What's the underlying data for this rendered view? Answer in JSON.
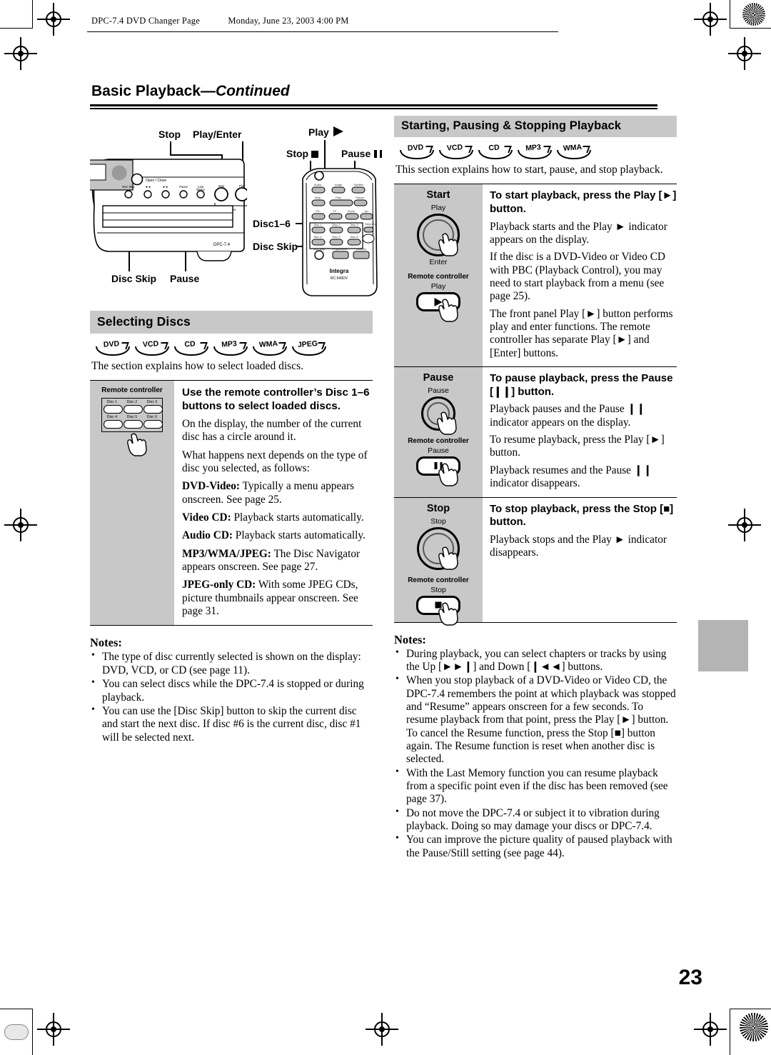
{
  "running_header": {
    "document": "DPC-7.4 DVD Changer  Page",
    "date": "Monday, June 23, 2003  4:00 PM"
  },
  "page_title": {
    "main": "Basic Playback",
    "continued": "—Continued"
  },
  "folio": "23",
  "illustration": {
    "front_panel_labels": {
      "stop": "Stop",
      "play_enter": "Play/Enter",
      "disc_skip": "Disc Skip",
      "pause": "Pause"
    },
    "front_panel_model": "DPC-7.4",
    "remote_labels": {
      "play": "Play",
      "stop": "Stop",
      "pause": "Pause",
      "disc_1_6": "Disc1–6",
      "disc_skip": "Disc Skip"
    },
    "remote_brand": "Integra",
    "remote_model": "RC-540DV"
  },
  "left_column": {
    "section_title": "Selecting Discs",
    "badges": [
      "DVD",
      "VCD",
      "CD",
      "MP3",
      "WMA",
      "JPEG"
    ],
    "intro": "The section explains how to select loaded discs.",
    "procedure": {
      "device_caption": "Remote controller",
      "keypad": [
        "Disc 1",
        "Disc 2",
        "Disc 3",
        "Disc 4",
        "Disc 5",
        "Disc 6"
      ],
      "heading": "Use the remote controller’s Disc 1–6 buttons to select loaded discs.",
      "paragraphs": [
        "On the display, the number of the current disc has a circle around it.",
        "What happens next depends on the type of disc you selected, as follows:"
      ],
      "disc_types": [
        {
          "term": "DVD-Video:",
          "desc": " Typically a menu appears onscreen. See page 25."
        },
        {
          "term": "Video CD:",
          "desc": " Playback starts automatically."
        },
        {
          "term": "Audio CD:",
          "desc": " Playback starts automatically."
        },
        {
          "term": "MP3/WMA/JPEG:",
          "desc": " The Disc Navigator appears onscreen. See page 27."
        },
        {
          "term": "JPEG-only CD:",
          "desc": " With some JPEG CDs, picture thumbnails appear onscreen. See page 31."
        }
      ]
    },
    "notes_title": "Notes:",
    "notes": [
      "The type of disc currently selected is shown on the display: DVD, VCD, or CD (see page 11).",
      "You can select discs while the DPC-7.4 is stopped or during playback.",
      "You can use the [Disc Skip] button to skip the current disc and start the next disc. If disc #6 is the current disc, disc #1 will be selected next."
    ]
  },
  "right_column": {
    "section_title": "Starting, Pausing & Stopping Playback",
    "badges": [
      "DVD",
      "VCD",
      "CD",
      "MP3",
      "WMA"
    ],
    "intro": "This section explains how to start, pause, and stop playback.",
    "rows": [
      {
        "label": "Start",
        "front_caption": "Play",
        "front_caption2": "Enter",
        "remote_caption": "Remote controller",
        "remote_button": "Play",
        "heading": "To start playback, press the Play [►] button.",
        "paragraphs": [
          "Playback starts and the Play ► indicator appears on the display.",
          "If the disc is a DVD-Video or Video CD with PBC (Playback Control), you may need to start playback from a menu (see page 25).",
          "The front panel Play [►] button performs play and enter functions. The remote controller has separate Play [►] and [Enter] buttons."
        ]
      },
      {
        "label": "Pause",
        "front_caption": "Pause",
        "remote_caption": "Remote controller",
        "remote_button": "Pause",
        "heading": "To pause playback, press the Pause [❙❙] button.",
        "paragraphs": [
          "Playback pauses and the Pause ❙❙ indicator appears on the display.",
          "To resume playback, press the Play [►] button.",
          "Playback resumes and the Pause ❙❙ indicator disappears."
        ]
      },
      {
        "label": "Stop",
        "front_caption": "Stop",
        "remote_caption": "Remote controller",
        "remote_button": "Stop",
        "heading": "To stop playback, press the Stop [■] button.",
        "paragraphs": [
          "Playback stops and the Play ► indicator disappears."
        ]
      }
    ],
    "notes_title": "Notes:",
    "notes": [
      "During playback, you can select chapters or tracks by using the Up [►►❙] and Down [❙◄◄] buttons.",
      "When you stop playback of a DVD-Video or Video CD, the DPC-7.4 remembers the point at which playback was stopped and “Resume” appears onscreen for a few seconds. To resume playback from that point, press the Play [►] button. To cancel the Resume function, press the Stop [■] button again. The Resume function is reset when another disc is selected.",
      "With the Last Memory function you can resume playback from a specific point even if the disc has been removed (see page 37).",
      "Do not move the DPC-7.4 or subject it to vibration during playback. Doing so may damage your discs or DPC-7.4.",
      "You can improve the picture quality of paused playback with the Pause/Still setting (see page 44)."
    ]
  },
  "colors": {
    "section_bar": "#c8c8c8",
    "panel_grey": "#c8c8c8",
    "tab_grey": "#b4b4b4"
  }
}
